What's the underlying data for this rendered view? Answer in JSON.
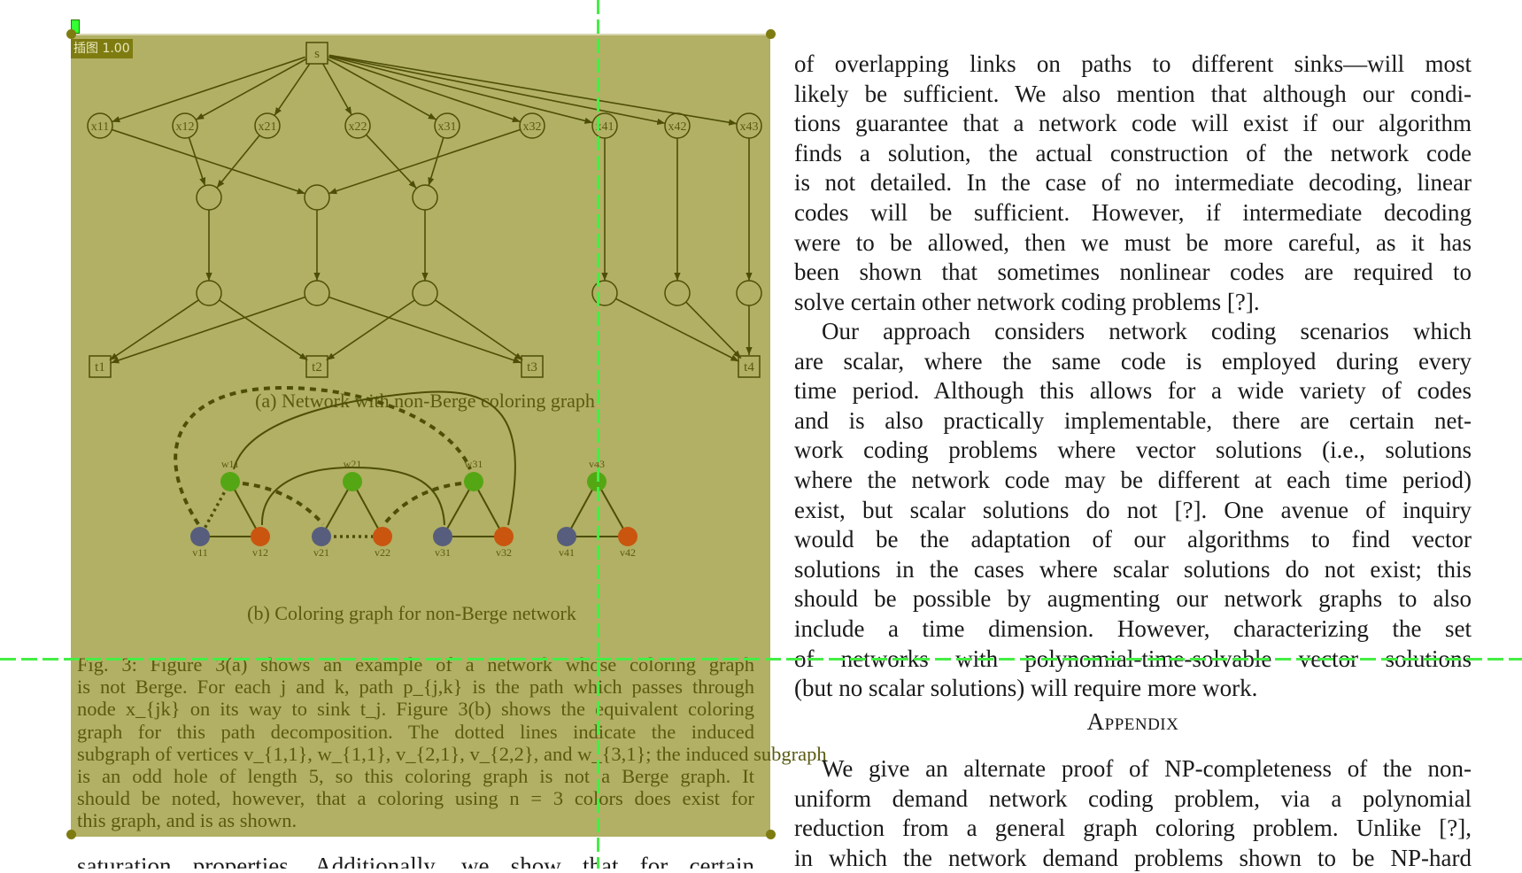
{
  "overlay": {
    "tag_label": "插图 1.00",
    "anchor_label": "0",
    "colors": {
      "fill": "#b1b064",
      "tag": "#7e7c10",
      "handle": "#7e7c10",
      "crosshair": "#44ee44"
    }
  },
  "figure": {
    "network": {
      "source": "s",
      "first_layer": [
        "x11",
        "x12",
        "x21",
        "x22",
        "x31",
        "x32",
        "x41",
        "x42",
        "x43"
      ],
      "sinks": [
        "t1",
        "t2",
        "t3",
        "t4"
      ],
      "subcaption": "(a) Network with non-Berge coloring graph"
    },
    "coloring_graph": {
      "top_nodes": [
        "w11",
        "w21",
        "w31",
        "v43"
      ],
      "bottom_nodes": [
        "v11",
        "v12",
        "v21",
        "v22",
        "v31",
        "v32",
        "v41",
        "v42"
      ],
      "node_colors": {
        "green": "#55a614",
        "blue": "#575d7c",
        "orange": "#c9550f"
      },
      "subcaption": "(b) Coloring graph for non-Berge network"
    },
    "caption_lines": [
      "Fig. 3: Figure 3(a) shows an example of a network whose coloring graph",
      "is not Berge. For each j and k, path p_{j,k} is the path which passes through",
      "node x_{jk} on its way to sink t_j. Figure 3(b) shows the equivalent coloring",
      "graph for this path decomposition. The dotted lines indicate the induced",
      "subgraph of vertices v_{1,1}, w_{1,1}, v_{2,1}, v_{2,2}, and w_{3,1}; the induced subgraph",
      "is an odd hole of length 5, so this coloring graph is not a Berge graph. It",
      "should be noted, however, that a coloring using n = 3 colors does exist for",
      "this graph, and is as shown."
    ]
  },
  "left_column_bottom": "saturation properties. Additionally, we show that for certain",
  "right_column": {
    "para1": [
      "of overlapping links on paths to different sinks—will most",
      "likely be sufficient. We also mention that although our condi-",
      "tions guarantee that a network code will exist if our algorithm",
      "finds a solution, the actual construction of the network code",
      "is not detailed. In the case of no intermediate decoding, linear",
      "codes will be sufficient. However, if intermediate decoding",
      "were to be allowed, then we must be more careful, as it has",
      "been shown that sometimes nonlinear codes are required to",
      "solve certain other network coding problems [?]."
    ],
    "para2": [
      "Our approach considers network coding scenarios which",
      "are scalar, where the same code is employed during every",
      "time period. Although this allows for a wide variety of codes",
      "and is also practically implementable, there are certain net-",
      "work coding problems where vector solutions (i.e., solutions",
      "where the network code may be different at each time period)",
      "exist, but scalar solutions do not [?]. One avenue of inquiry",
      "would be the adaptation of our algorithms to find vector",
      "solutions in the cases where scalar solutions do not exist; this",
      "should be possible by augmenting our network graphs to also",
      "include a time dimension. However, characterizing the set",
      "of networks with polynomial-time-solvable vector solutions",
      "(but no scalar solutions) will require more work."
    ],
    "appendix_heading": "Appendix",
    "para3": [
      "We give an alternate proof of NP-completeness of the non-",
      "uniform demand network coding problem, via a polynomial",
      "reduction from a general graph coloring problem. Unlike [?],",
      "in which the network demand problems shown to be NP-hard"
    ]
  }
}
